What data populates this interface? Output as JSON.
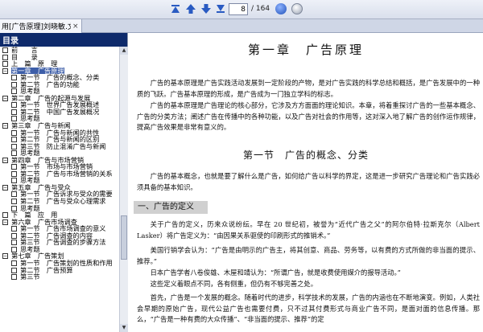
{
  "toolbar": {
    "page_current": "8",
    "page_total": "/ 164",
    "buttons": [
      "first-page-icon",
      "prev-page-icon",
      "next-page-icon",
      "last-page-icon",
      "goto-icon",
      "zoom-icon"
    ]
  },
  "tab": {
    "label": "用[广告原理]刘晓敏.文...",
    "close": "×"
  },
  "sidebar": {
    "header": "目录",
    "items": [
      {
        "indent": 0,
        "label": "前　　言",
        "expander": "",
        "sel": false
      },
      {
        "indent": 0,
        "label": "目　　录",
        "expander": "",
        "sel": false
      },
      {
        "indent": 0,
        "label": "上　篇　原　理",
        "expander": "",
        "sel": false
      },
      {
        "indent": 0,
        "label": "第一章　广告原理",
        "expander": "−",
        "sel": true
      },
      {
        "indent": 1,
        "label": "第一节　广告的概念、分类",
        "expander": "",
        "sel": false
      },
      {
        "indent": 1,
        "label": "第二节　广告的功能",
        "expander": "",
        "sel": false
      },
      {
        "indent": 1,
        "label": "思考题",
        "expander": "",
        "sel": false
      },
      {
        "indent": 0,
        "label": "第二章　广告的起源与发展",
        "expander": "−",
        "sel": false
      },
      {
        "indent": 1,
        "label": "第一节　世界广告发展概述",
        "expander": "",
        "sel": false
      },
      {
        "indent": 1,
        "label": "第二节　中国广告发展概况",
        "expander": "",
        "sel": false
      },
      {
        "indent": 1,
        "label": "思考题",
        "expander": "",
        "sel": false
      },
      {
        "indent": 0,
        "label": "第三章　广告与新闻",
        "expander": "−",
        "sel": false
      },
      {
        "indent": 1,
        "label": "第一节　广告与新闻的共性",
        "expander": "",
        "sel": false
      },
      {
        "indent": 1,
        "label": "第二节　广告与新闻的区别",
        "expander": "",
        "sel": false
      },
      {
        "indent": 1,
        "label": "第三节　防止混淆广告与新闻",
        "expander": "",
        "sel": false
      },
      {
        "indent": 1,
        "label": "思考题",
        "expander": "",
        "sel": false
      },
      {
        "indent": 0,
        "label": "第四章　广告与市场营销",
        "expander": "−",
        "sel": false
      },
      {
        "indent": 1,
        "label": "第一节　市场与市场营销",
        "expander": "",
        "sel": false
      },
      {
        "indent": 1,
        "label": "第二节　广告与市场营销的关系",
        "expander": "",
        "sel": false
      },
      {
        "indent": 1,
        "label": "思考题",
        "expander": "",
        "sel": false
      },
      {
        "indent": 0,
        "label": "第五章　广告与受众",
        "expander": "−",
        "sel": false
      },
      {
        "indent": 1,
        "label": "第一节　广告诉求与受众的需要",
        "expander": "",
        "sel": false
      },
      {
        "indent": 1,
        "label": "第二节　广告与受众心理需求",
        "expander": "",
        "sel": false
      },
      {
        "indent": 1,
        "label": "思考题",
        "expander": "",
        "sel": false
      },
      {
        "indent": 0,
        "label": "下　篇　应　用",
        "expander": "",
        "sel": false
      },
      {
        "indent": 0,
        "label": "第六章　广告市场调查",
        "expander": "−",
        "sel": false
      },
      {
        "indent": 1,
        "label": "第一节　广告市场调查的意义",
        "expander": "",
        "sel": false
      },
      {
        "indent": 1,
        "label": "第二节　广告调查的内容",
        "expander": "",
        "sel": false
      },
      {
        "indent": 1,
        "label": "第三节　广告调查的步骤方法",
        "expander": "",
        "sel": false
      },
      {
        "indent": 1,
        "label": "思考题",
        "expander": "",
        "sel": false
      },
      {
        "indent": 0,
        "label": "第七章　广告策划",
        "expander": "−",
        "sel": false
      },
      {
        "indent": 1,
        "label": "第一节　广告策划的性质和作用",
        "expander": "",
        "sel": false
      },
      {
        "indent": 1,
        "label": "第二节　广告预算",
        "expander": "",
        "sel": false
      },
      {
        "indent": 1,
        "label": "第三节　",
        "expander": "",
        "sel": false
      }
    ]
  },
  "doc": {
    "chapter_title": "第一章　广告原理",
    "p1": "广告的基本原理是广告实践活动发展到一定阶段的产物，是对广告实践的科学总结和概括，是广告发展中的一种质的飞跃。广告基本原理的形成，是广告成为一门独立学科的标志。",
    "p2": "广告的基本原理是广告理论的核心部分，它涉及方方面面的理论知识。本章，将着重探讨广告的一些基本概念、广告的分类方法；阐述广告在传播中的各种功能，以及广告对社会的作用等，这对深入地了解广告的创作运作规律，提高广告效果是非常有意义的。",
    "section_title": "第一节　广告的概念、分类",
    "p3": "广告的基本概念，也就是要了解什么是广告，如何给广告以科学的界定，这是进一步研究广告理论和广告实践必须具备的基本知识。",
    "subhead": "一、广告的定义",
    "p4": "关于广告的定义，历来众说纷纭。早在 20 世纪初，被誉为“近代广告之父”的阿尔伯特·拉斯克尔（Albert　Lasker）将广告定义为：“由因果关系驱使的印刷形式的推销术。”",
    "p5": "美国行销学会认为：“广告是由明示的广告主，将其创意、商品、劳务等，以有费的方式所做的非当面的提示、推荐。”",
    "p6": "日本广告学者八卷俊雄、木屋和靖认为：“所谓广告，就是收费使用媒介的报导活动。”",
    "p7": "这些定义着眼点不同，各有侧重，但仍有不够完善之处。",
    "p8": "首先，广告是一个发展的概念。随着时代的进步，科学技术的发展，广告的内涵也在不断地演变。例如，人类社会早期的原始广告，现代公益广告也需要付费，只不过其付费形式与商业广告不同，是面对面的信息传播。那么，“广告是一种有费的大众传播”、“非当面的提示、推荐”的定"
  }
}
